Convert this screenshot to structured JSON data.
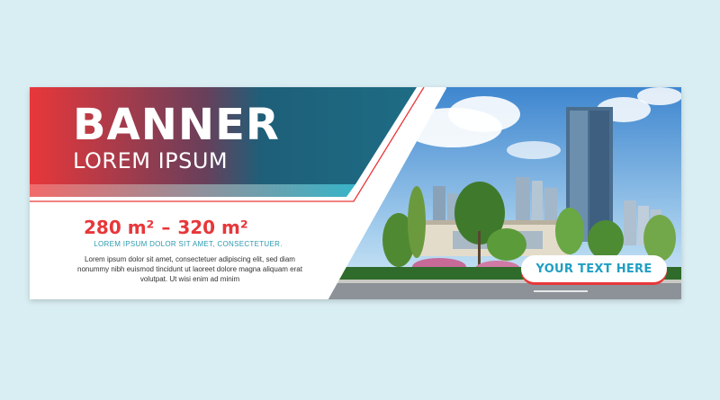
{
  "banner": {
    "title": "BANNER",
    "subtitle": "LOREM IPSUM",
    "area_min": "280 m²",
    "area_separator": "–",
    "area_max": "320 m²",
    "tagline": "LOREM IPSUM DOLOR SIT AMET, CONSECTETUER.",
    "body": "Lorem ipsum dolor sit amet, consectetuer adipiscing elit, sed diam nonummy nibh euismod tincidunt ut laoreet dolore magna aliquam erat volutpat. Ut wisi enim ad minim",
    "cta_label": "YOUR TEXT HERE"
  },
  "colors": {
    "page_bg": "#d9eef3",
    "gradient_red": "#e8373a",
    "gradient_teal": "#1e6c84",
    "accent_red": "#e8373a",
    "accent_blue": "#1f9fc4"
  },
  "icons": {
    "photo": "city-skyline-photo"
  }
}
